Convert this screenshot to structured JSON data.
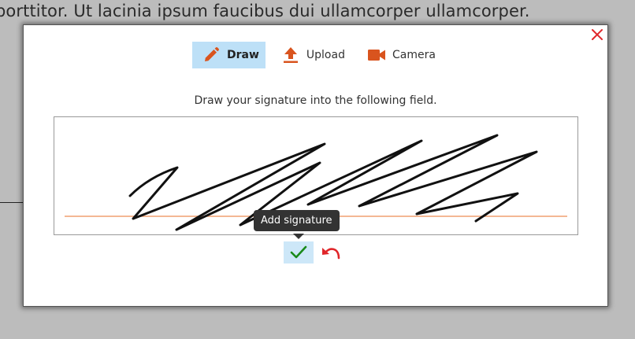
{
  "background": {
    "text": "porttitor. Ut lacinia ipsum faucibus dui ullamcorper ullamcorper."
  },
  "dialog": {
    "close_icon": "close-icon",
    "tabs": [
      {
        "label": "Draw",
        "icon": "pencil-icon",
        "active": true
      },
      {
        "label": "Upload",
        "icon": "upload-icon",
        "active": false
      },
      {
        "label": "Camera",
        "icon": "camera-icon",
        "active": false
      }
    ],
    "instruction": "Draw your signature into the following field.",
    "tooltip": "Add signature",
    "confirm_icon": "checkmark-icon",
    "undo_icon": "undo-icon"
  },
  "colors": {
    "accent": "#d9541e",
    "active_tab_bg": "#bde0f7",
    "close_red": "#e0262a",
    "confirm_green": "#1a8a1a",
    "baseline_orange": "#f0a070"
  }
}
